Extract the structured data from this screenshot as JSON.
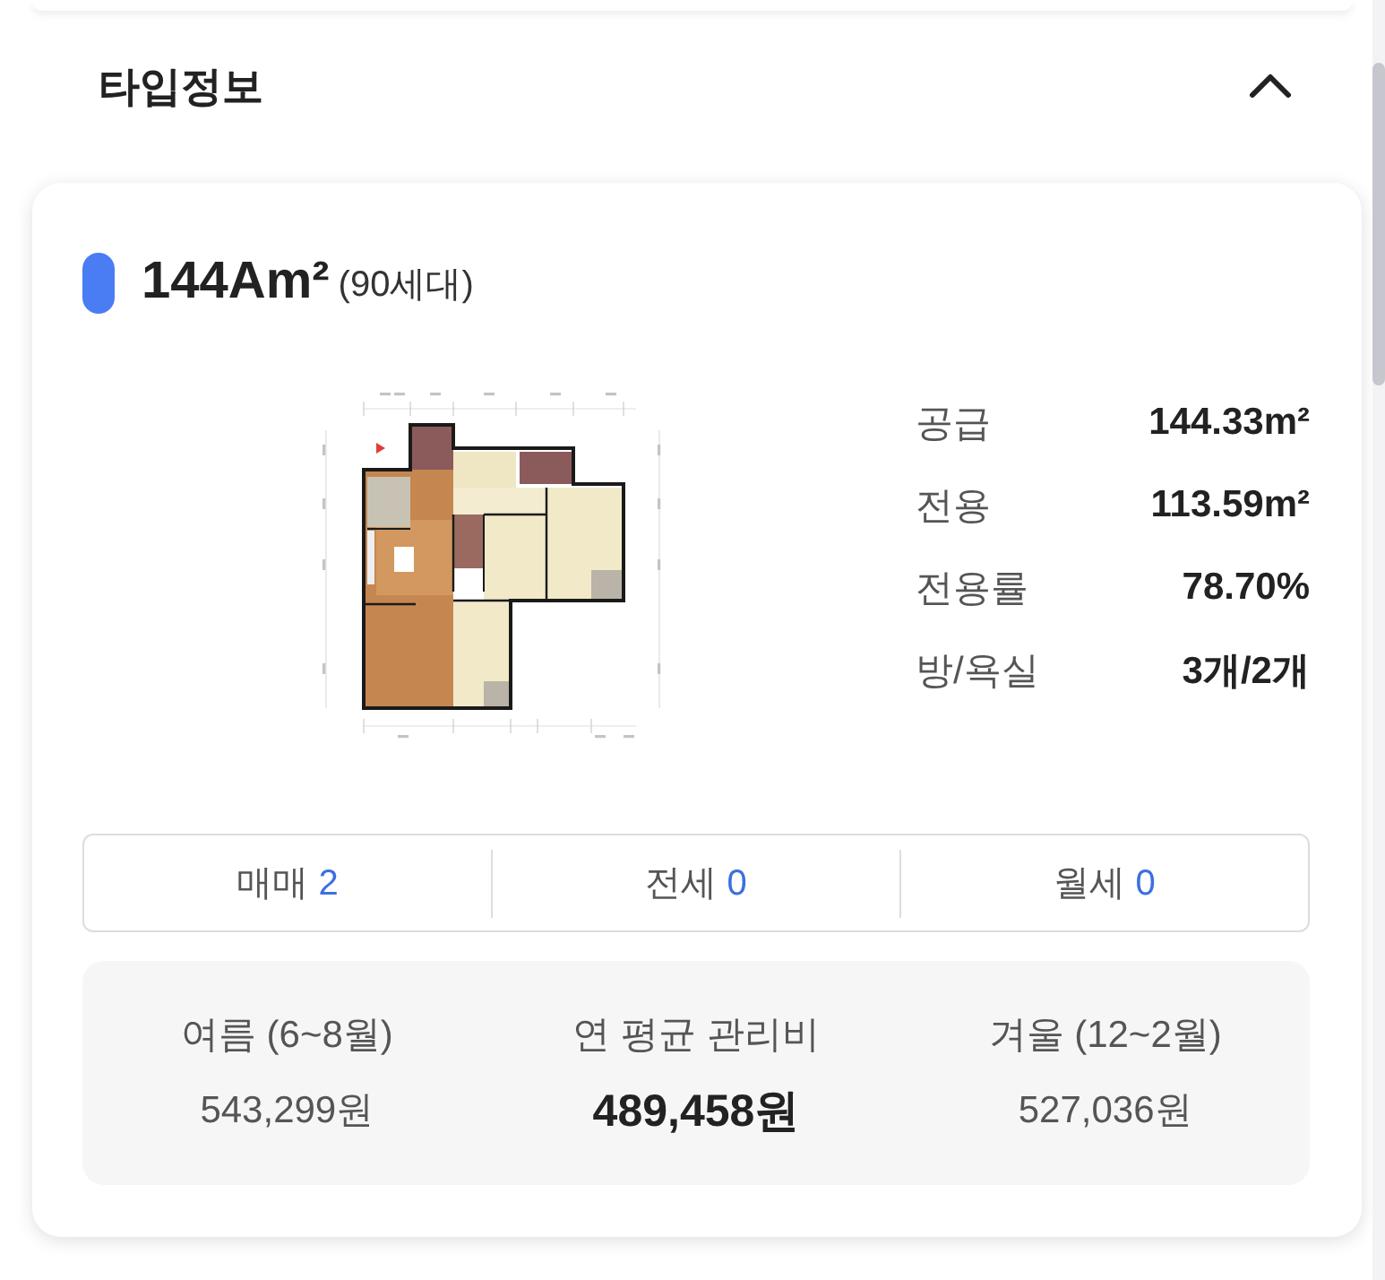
{
  "section": {
    "title": "타입정보",
    "expanded": true
  },
  "type_card": {
    "name": "144Am²",
    "households": "(90세대)",
    "specs": [
      {
        "label": "공급",
        "value": "144.33m²"
      },
      {
        "label": "전용",
        "value": "113.59m²"
      },
      {
        "label": "전용률",
        "value": "78.70%"
      },
      {
        "label": "방/욕실",
        "value": "3개/2개"
      }
    ],
    "deals": [
      {
        "label": "매매",
        "count": "2"
      },
      {
        "label": "전세",
        "count": "0"
      },
      {
        "label": "월세",
        "count": "0"
      }
    ],
    "fees": [
      {
        "kind": "season",
        "label": "여름 (6~8월)",
        "value": "543,299원"
      },
      {
        "kind": "average",
        "label": "연 평균 관리비",
        "value": "489,458원"
      },
      {
        "kind": "season",
        "label": "겨울 (12~2월)",
        "value": "527,036원"
      }
    ]
  }
}
